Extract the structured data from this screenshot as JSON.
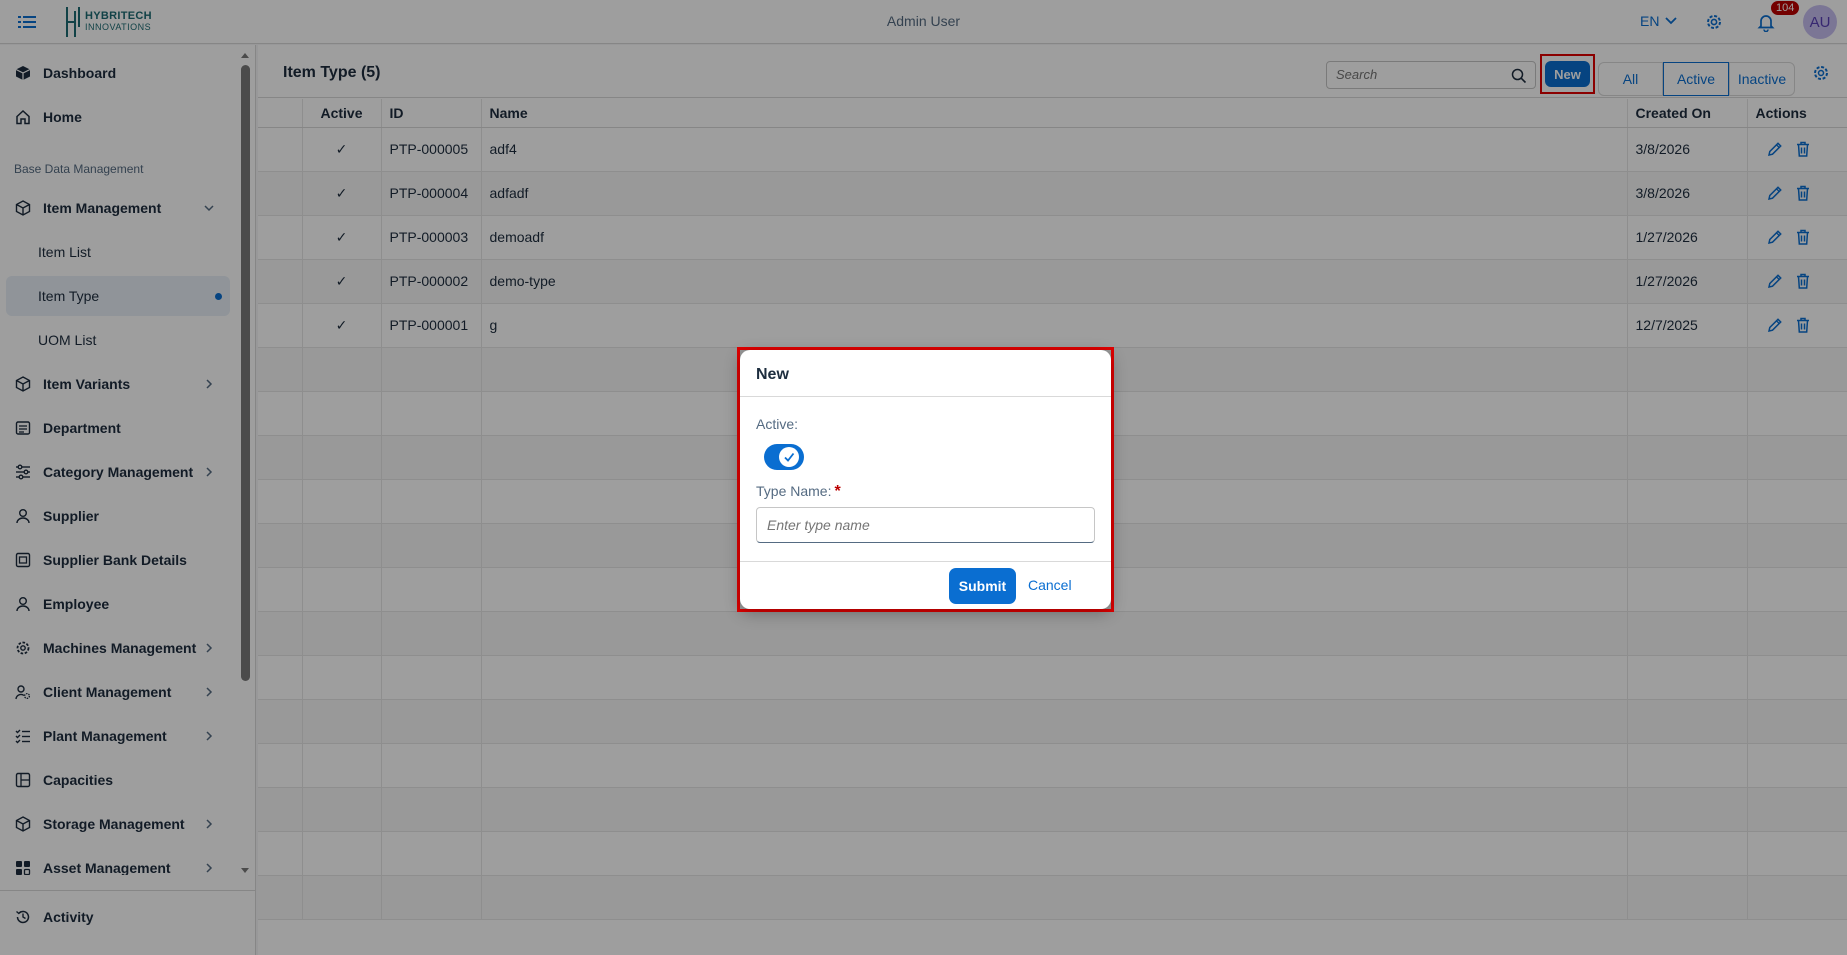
{
  "header": {
    "logo_line1": "HYBRITECH",
    "logo_line2": "INNOVATIONS",
    "user": "Admin User",
    "language": "EN",
    "notifications": "104",
    "avatar_initials": "AU"
  },
  "sidebar": {
    "dashboard": "Dashboard",
    "home": "Home",
    "group_label": "Base Data Management",
    "item_management": "Item Management",
    "item_list": "Item List",
    "item_type": "Item Type",
    "uom_list": "UOM List",
    "item_variants": "Item Variants",
    "department": "Department",
    "category_management": "Category Management",
    "supplier": "Supplier",
    "supplier_bank_details": "Supplier Bank Details",
    "employee": "Employee",
    "machines_management": "Machines Management",
    "client_management": "Client Management",
    "plant_management": "Plant Management",
    "capacities": "Capacities",
    "storage_management": "Storage Management",
    "asset_management": "Asset Management",
    "activity": "Activity"
  },
  "toolbar": {
    "title": "Item Type (5)",
    "search_placeholder": "Search",
    "new_label": "New",
    "filter_all": "All",
    "filter_active": "Active",
    "filter_inactive": "Inactive"
  },
  "table": {
    "columns": [
      "Active",
      "ID",
      "Name",
      "Created On",
      "Actions"
    ],
    "rows": [
      {
        "active": "✓",
        "id": "PTP-000005",
        "name": "adf4",
        "created": "3/8/2026"
      },
      {
        "active": "✓",
        "id": "PTP-000004",
        "name": "adfadf",
        "created": "3/8/2026"
      },
      {
        "active": "✓",
        "id": "PTP-000003",
        "name": "demoadf",
        "created": "1/27/2026"
      },
      {
        "active": "✓",
        "id": "PTP-000002",
        "name": "demo-type",
        "created": "1/27/2026"
      },
      {
        "active": "✓",
        "id": "PTP-000001",
        "name": "g",
        "created": "12/7/2025"
      }
    ]
  },
  "dialog": {
    "title": "New",
    "active_label": "Active:",
    "active_value": true,
    "type_name_label": "Type Name:",
    "required_mark": "*",
    "type_name_placeholder": "Enter type name",
    "submit_label": "Submit",
    "cancel_label": "Cancel"
  },
  "colors": {
    "accent": "#0a6ed1",
    "highlight": "#e00000",
    "badge": "#bb0000"
  }
}
